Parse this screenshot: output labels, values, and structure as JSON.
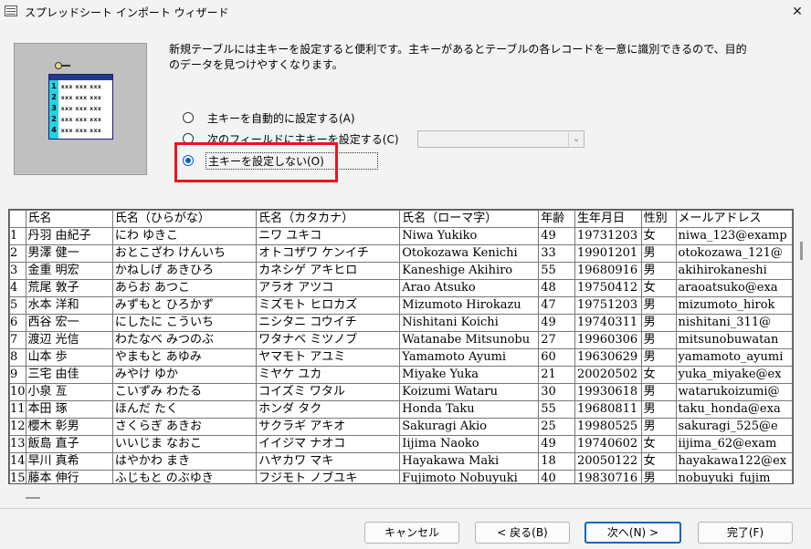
{
  "window": {
    "title": "スプレッドシート インポート ウィザード",
    "close_glyph": "✕"
  },
  "description": "新規テーブルには主キーを設定すると便利です。主キーがあるとテーブルの各レコードを一意に識別できるので、目的のデータを見つけやすくなります。",
  "illustration": {
    "row_numbers": [
      "1",
      "2",
      "3",
      "2",
      "4"
    ],
    "row_text": "xxx xxx xxx"
  },
  "options": [
    {
      "label": "主キーを自動的に設定する(A)",
      "checked": false
    },
    {
      "label": "次のフィールドに主キーを設定する(C)",
      "checked": false
    },
    {
      "label": "主キーを設定しない(O)",
      "checked": true
    }
  ],
  "field_combo": {
    "value": ""
  },
  "table": {
    "columns": [
      "氏名",
      "氏名（ひらがな）",
      "氏名（カタカナ）",
      "氏名（ローマ字）",
      "年齢",
      "生年月日",
      "性別",
      "メールアドレス"
    ],
    "rows": [
      [
        "1",
        "丹羽 由紀子",
        "にわ ゆきこ",
        "ニワ ユキコ",
        "Niwa Yukiko",
        "49",
        "19731203",
        "女",
        "niwa_123@examp"
      ],
      [
        "2",
        "男澤 健一",
        "おとこざわ けんいち",
        "オトコザワ ケンイチ",
        "Otokozawa Kenichi",
        "33",
        "19901201",
        "男",
        "otokozawa_121@"
      ],
      [
        "3",
        "金重 明宏",
        "かねしげ あきひろ",
        "カネシゲ アキヒロ",
        "Kaneshige Akihiro",
        "55",
        "19680916",
        "男",
        "akihirokaneshi"
      ],
      [
        "4",
        "荒尾 敦子",
        "あらお あつこ",
        "アラオ アツコ",
        "Arao Atsuko",
        "48",
        "19750412",
        "女",
        "araoatsuko@exa"
      ],
      [
        "5",
        "水本 洋和",
        "みずもと ひろかず",
        "ミズモト ヒロカズ",
        "Mizumoto Hirokazu",
        "47",
        "19751203",
        "男",
        "mizumoto_hirok"
      ],
      [
        "6",
        "西谷 宏一",
        "にしたに こういち",
        "ニシタニ コウイチ",
        "Nishitani Koichi",
        "49",
        "19740311",
        "男",
        "nishitani_311@"
      ],
      [
        "7",
        "渡辺 光信",
        "わたなべ みつのぶ",
        "ワタナベ ミツノブ",
        "Watanabe Mitsunobu",
        "27",
        "19960306",
        "男",
        "mitsunobuwatan"
      ],
      [
        "8",
        "山本 歩",
        "やまもと あゆみ",
        "ヤマモト アユミ",
        "Yamamoto Ayumi",
        "60",
        "19630629",
        "男",
        "yamamoto_ayumi"
      ],
      [
        "9",
        "三宅 由佳",
        "みやけ ゆか",
        "ミヤケ ユカ",
        "Miyake Yuka",
        "21",
        "20020502",
        "女",
        "yuka_miyake@ex"
      ],
      [
        "10",
        "小泉 亙",
        "こいずみ わたる",
        "コイズミ ワタル",
        "Koizumi Wataru",
        "30",
        "19930618",
        "男",
        "watarukoizumi@"
      ],
      [
        "11",
        "本田 琢",
        "ほんだ たく",
        "ホンダ タク",
        "Honda Taku",
        "55",
        "19680811",
        "男",
        "taku_honda@exa"
      ],
      [
        "12",
        "櫻木 彰男",
        "さくらぎ あきお",
        "サクラギ アキオ",
        "Sakuragi Akio",
        "25",
        "19980525",
        "男",
        "sakuragi_525@e"
      ],
      [
        "13",
        "飯島 直子",
        "いいじま なおこ",
        "イイジマ ナオコ",
        "Iijima Naoko",
        "49",
        "19740602",
        "女",
        "iijima_62@exam"
      ],
      [
        "14",
        "早川 真希",
        "はやかわ まき",
        "ハヤカワ マキ",
        "Hayakawa Maki",
        "18",
        "20050122",
        "女",
        "hayakawa122@ex"
      ],
      [
        "15",
        "藤本 伸行",
        "ふじもと のぶゆき",
        "フジモト ノブユキ",
        "Fujimoto Nobuyuki",
        "40",
        "19830716",
        "男",
        "nobuyuki_fujim"
      ]
    ]
  },
  "buttons": {
    "cancel": "キャンセル",
    "back": "< 戻る(B)",
    "next": "次へ(N) >",
    "finish": "完了(F)"
  }
}
